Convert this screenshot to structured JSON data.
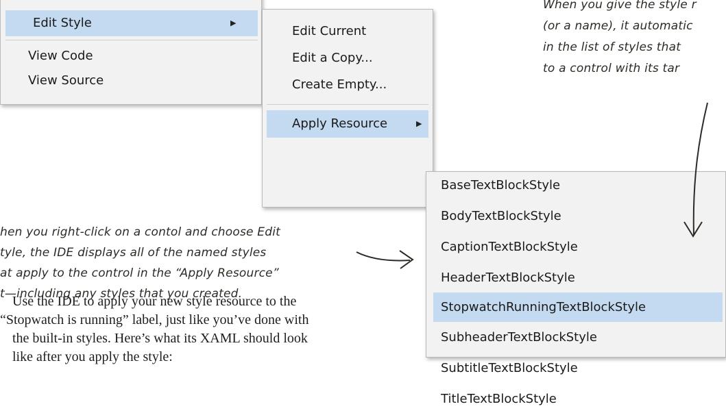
{
  "context_menu": {
    "edit_style": "Edit Style",
    "view_code": "View Code",
    "view_source": "View Source"
  },
  "edit_style_submenu": {
    "edit_current": "Edit Current",
    "edit_a_copy": "Edit a Copy...",
    "create_empty": "Create Empty...",
    "apply_resource": "Apply Resource"
  },
  "apply_resource_submenu": {
    "items": [
      "BaseTextBlockStyle",
      "BodyTextBlockStyle",
      "CaptionTextBlockStyle",
      "HeaderTextBlockStyle",
      "StopwatchRunningTextBlockStyle",
      "SubheaderTextBlockStyle",
      "SubtitleTextBlockStyle",
      "TitleTextBlockStyle"
    ],
    "selected": "StopwatchRunningTextBlockStyle"
  },
  "annotation_right": {
    "lines": [
      "When you give the style r",
      "(or a name), it automatic",
      "in the list of styles that",
      "to a control with its tar"
    ]
  },
  "annotation_left": {
    "lines": [
      "hen you right-click on a contol and choose Edit",
      "tyle, the IDE displays all of the named styles",
      "at apply to the control in the “Apply Resource”",
      "t—including any styles that you created."
    ]
  },
  "body_text": {
    "lines": [
      "Use the IDE to apply your new style resource to the",
      "“Stopwatch is running” label, just like you’ve done with",
      "the built-in styles. Here’s what its XAML should look",
      "like after you apply the style:"
    ]
  }
}
